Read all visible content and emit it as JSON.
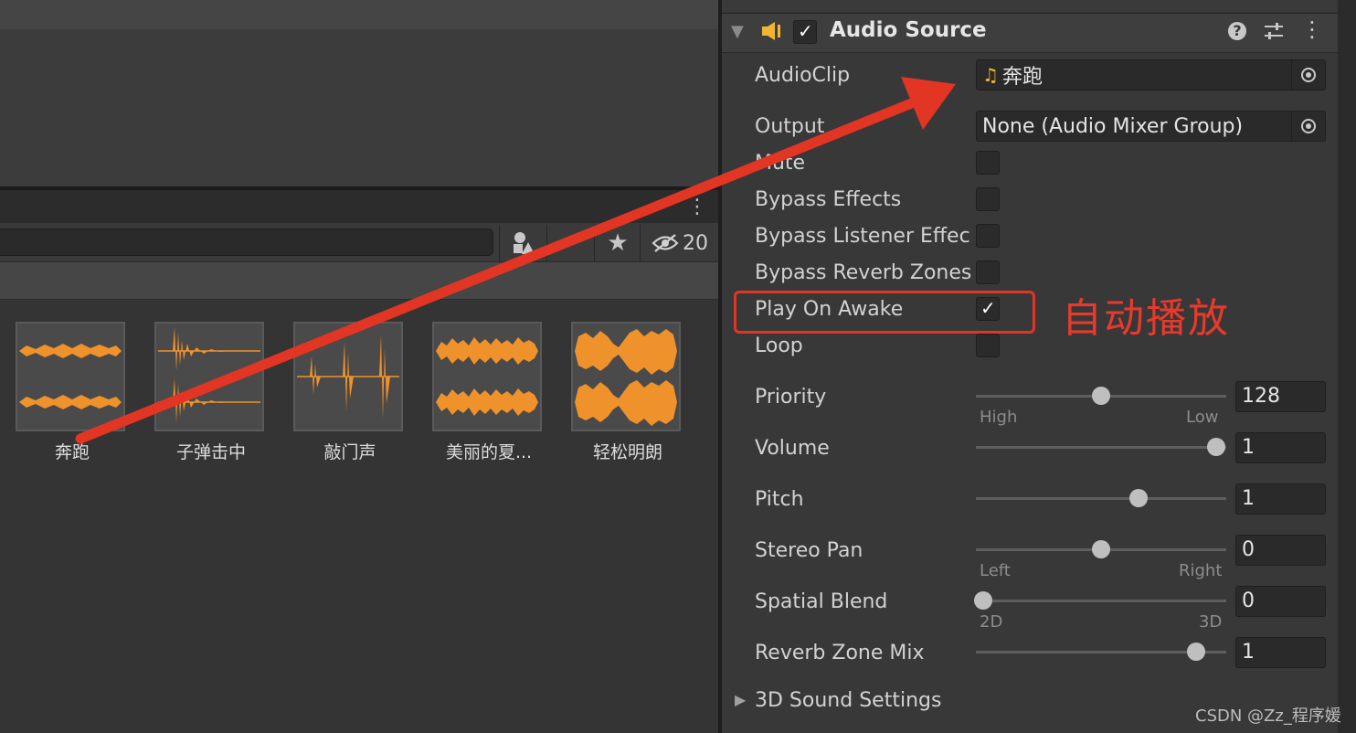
{
  "project": {
    "hidden_count": "20",
    "assets": [
      {
        "label": "奔跑"
      },
      {
        "label": "子弹击中"
      },
      {
        "label": "敲门声"
      },
      {
        "label": "美丽的夏..."
      },
      {
        "label": "轻松明朗"
      }
    ]
  },
  "inspector": {
    "component_title": "Audio Source",
    "component_enabled": true,
    "fields": {
      "audioclip_label": "AudioClip",
      "audioclip_value": "奔跑",
      "output_label": "Output",
      "output_value": "None (Audio Mixer Group)",
      "mute_label": "Mute",
      "bypass_effects_label": "Bypass Effects",
      "bypass_listener_label": "Bypass Listener Effec",
      "bypass_reverb_label": "Bypass Reverb Zones",
      "play_on_awake_label": "Play On Awake",
      "loop_label": "Loop"
    },
    "checkboxes": {
      "mute": false,
      "bypass_effects": false,
      "bypass_listener": false,
      "bypass_reverb": false,
      "play_on_awake": true,
      "loop": false
    },
    "sliders": {
      "priority": {
        "label": "Priority",
        "value": "128",
        "min_label": "High",
        "max_label": "Low",
        "fraction": 0.5
      },
      "volume": {
        "label": "Volume",
        "value": "1",
        "fraction": 0.96
      },
      "pitch": {
        "label": "Pitch",
        "value": "1",
        "fraction": 0.65
      },
      "stereo_pan": {
        "label": "Stereo Pan",
        "value": "0",
        "min_label": "Left",
        "max_label": "Right",
        "fraction": 0.5
      },
      "spatial_blend": {
        "label": "Spatial Blend",
        "value": "0",
        "min_label": "2D",
        "max_label": "3D",
        "fraction": 0.03
      },
      "reverb_zone_mix": {
        "label": "Reverb Zone Mix",
        "value": "1",
        "fraction": 0.88
      }
    },
    "sound_settings_label": "3D Sound Settings"
  },
  "annotation": {
    "text": "自动播放",
    "color": "#e83a2c"
  },
  "watermark": "CSDN @Zz_程序媛",
  "colors": {
    "waveform": "#f0922b",
    "checkbox_check": "#ffffff",
    "audio_icon": "#f2b530"
  }
}
